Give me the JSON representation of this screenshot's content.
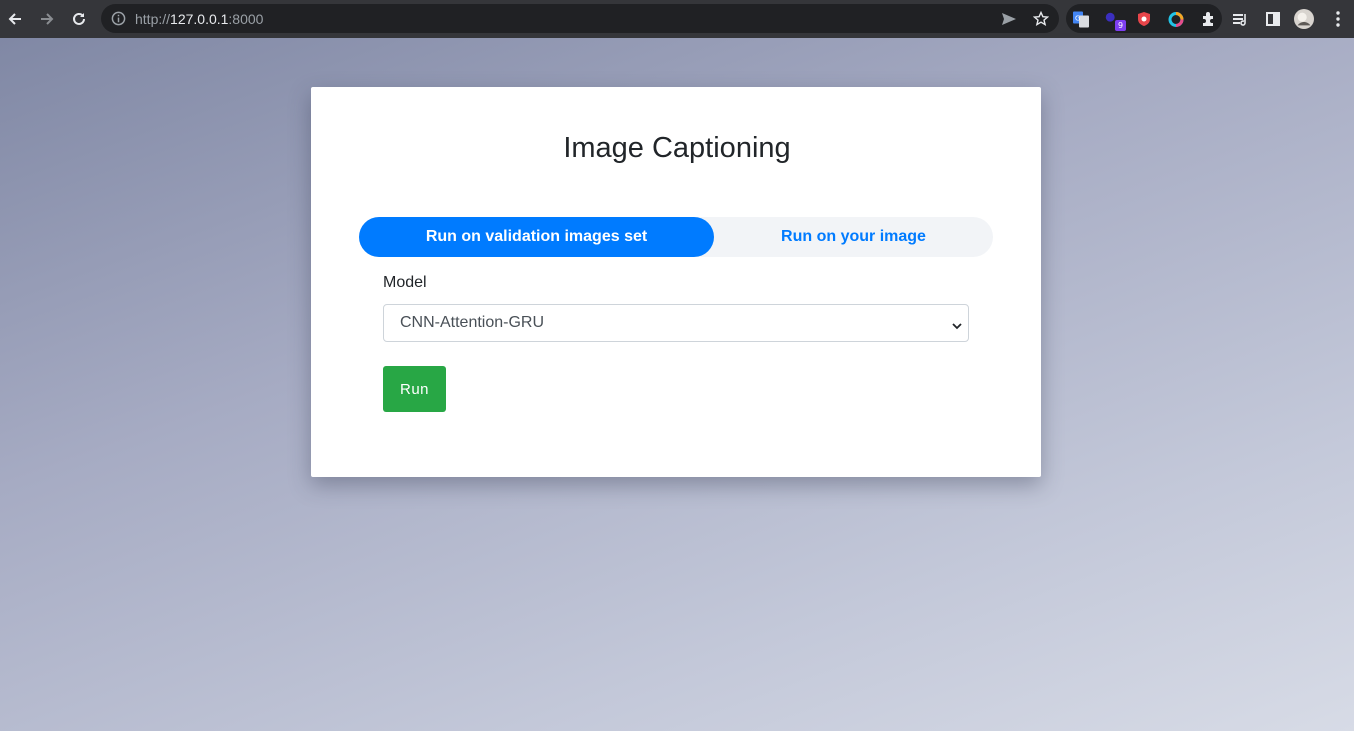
{
  "browser": {
    "url_scheme": "http://",
    "url_host": "127.0.0.1",
    "url_port": ":8000",
    "extension_badge": "9",
    "icons": {
      "back": "back-arrow-icon",
      "forward": "forward-arrow-icon",
      "reload": "reload-icon",
      "info": "info-icon",
      "send": "send-icon",
      "bookmark": "star-icon",
      "translate": "google-translate-icon",
      "extensions": "puzzle-icon",
      "reading_list": "reading-list-icon",
      "side_panel": "side-panel-icon",
      "menu": "kebab-menu-icon"
    }
  },
  "page": {
    "title": "Image Captioning",
    "tabs": [
      {
        "label": "Run on validation images set",
        "active": true
      },
      {
        "label": "Run on your image",
        "active": false
      }
    ],
    "model_label": "Model",
    "model_selected": "CNN-Attention-GRU",
    "run_label": "Run"
  },
  "colors": {
    "primary": "#007bff",
    "success": "#28a745",
    "chrome_bg": "#35363a",
    "omnibox_bg": "#202124"
  }
}
